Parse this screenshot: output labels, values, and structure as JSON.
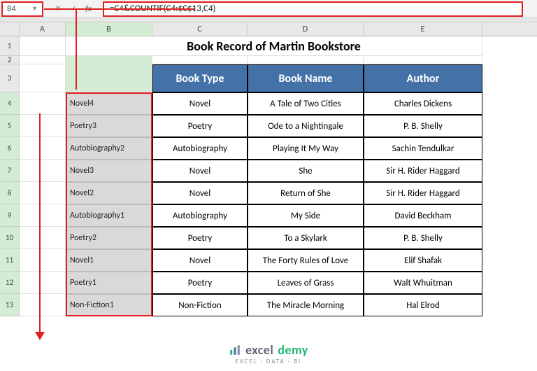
{
  "nameBox": "B4",
  "formula": "=C4&COUNTIF(C4:$C$13,C4)",
  "columns": [
    "A",
    "B",
    "C",
    "D",
    "E"
  ],
  "title": "Book Record of Martin Bookstore",
  "headers": {
    "c": "Book Type",
    "d": "Book Name",
    "e": "Author"
  },
  "rows": [
    {
      "n": "4",
      "b": "Novel4",
      "c": "Novel",
      "d": "A Tale of Two Cities",
      "e": "Charles Dickens"
    },
    {
      "n": "5",
      "b": "Poetry3",
      "c": "Poetry",
      "d": "Ode to a Nightingale",
      "e": "P. B. Shelly"
    },
    {
      "n": "6",
      "b": "Autobiography2",
      "c": "Autobiography",
      "d": "Playing It My Way",
      "e": "Sachin Tendulkar"
    },
    {
      "n": "7",
      "b": "Novel3",
      "c": "Novel",
      "d": "She",
      "e": "Sir H. Rider Haggard"
    },
    {
      "n": "8",
      "b": "Novel2",
      "c": "Novel",
      "d": "Return of She",
      "e": "Sir H. Rider Haggard"
    },
    {
      "n": "9",
      "b": "Autobiography1",
      "c": "Autobiography",
      "d": "My Side",
      "e": "David Beckham"
    },
    {
      "n": "10",
      "b": "Poetry2",
      "c": "Poetry",
      "d": "To a Skylark",
      "e": "P. B. Shelly"
    },
    {
      "n": "11",
      "b": "Novel1",
      "c": "Novel",
      "d": "The Forty Rules of Love",
      "e": "Elif Shafak"
    },
    {
      "n": "12",
      "b": "Poetry1",
      "c": "Poetry",
      "d": "Leaves of Grass",
      "e": "Walt Whuitman"
    },
    {
      "n": "13",
      "b": "Non-Fiction1",
      "c": "Non-Fiction",
      "d": "The Miracle Morning",
      "e": "Hal Elrod"
    }
  ],
  "logo": {
    "brand1": "excel",
    "brand2": "demy",
    "tag": "EXCEL · DATA · BI"
  },
  "chart_data": {
    "type": "table",
    "title": "Book Record of Martin Bookstore"
  }
}
